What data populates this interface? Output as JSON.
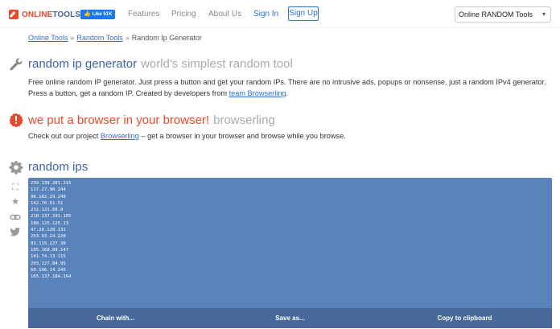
{
  "nav": {
    "logo_online": "ONLINE",
    "logo_tools": "TOOLS",
    "fb_like": "Like 51K",
    "links": {
      "features": "Features",
      "pricing": "Pricing",
      "about": "About Us",
      "signin": "Sign In",
      "signup": "Sign Up"
    },
    "select_value": "Online RANDOM Tools"
  },
  "breadcrumb": {
    "items": [
      "Online Tools",
      "Random Tools",
      "Random Ip Generator"
    ],
    "separator": "»"
  },
  "intro": {
    "title": "random ip generator",
    "subtitle": "world's simplest random tool",
    "text": "Free online random IP generator. Just press a button and get your random IPs. There are no intrusive ads, popups or nonsense, just a random IPv4 generator. Press a button, get a random IP. Created by developers from ",
    "link": "team Browserling",
    "text_end": "."
  },
  "promo": {
    "title": "we put a browser in your browser!",
    "subtitle": "browserling",
    "text_start": "Check out our project ",
    "link": "Browserling",
    "text_end": " – get a browser in your browser and browse while you browse."
  },
  "tool": {
    "title": "random ips",
    "output": "239.139.201.215\n117.27.98.244\n98.182.29.240\n142.76.61.51\n232.121.68.9\n210.137.191.105\n188.125.125.13\n47.28.128.131\n253.93.24.220\n93.115.227.30\n105.168.89.147\n141.74.13.115\n203.127.84.95\n60.196.14.245\n165.137.184.164",
    "buttons": {
      "chain": "Chain with...",
      "save": "Save as...",
      "copy": "Copy to clipboard"
    }
  },
  "colors": {
    "brand_red": "#e8492a",
    "brand_blue": "#3e63a8",
    "tool_bg": "#5983bb",
    "tool_bar": "#47699a"
  }
}
